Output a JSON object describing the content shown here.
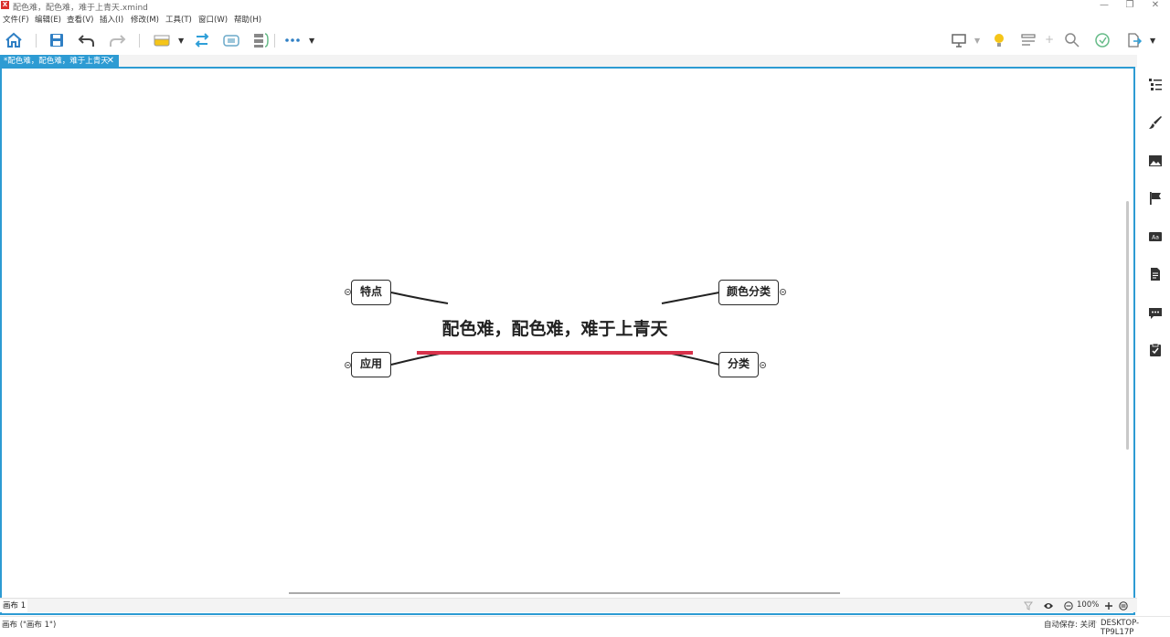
{
  "window": {
    "title": "配色难，配色难，难于上青天.xmind",
    "logo": "X"
  },
  "menu": [
    "文件(F)",
    "编辑(E)",
    "查看(V)",
    "插入(I)",
    "修改(M)",
    "工具(T)",
    "窗口(W)",
    "帮助(H)"
  ],
  "tab": {
    "label": "*配色难，配色难，难于上青天",
    "close": "✕"
  },
  "mindmap": {
    "central": "配色难，配色难，难于上青天",
    "topics": {
      "top_left": "特点",
      "bottom_left": "应用",
      "top_right": "颜色分类",
      "bottom_right": "分类"
    },
    "accent_color": "#d8314a"
  },
  "statusbar": {
    "sheet": "画布 1",
    "zoom": "100%"
  },
  "bottombar": {
    "left": "画布 (\"画布 1\")",
    "autosave": "自动保存: 关闭",
    "machine": "DESKTOP-TP9L17P"
  },
  "colors": {
    "accent_blue": "#2d9bd3",
    "icon_blue": "#2f7fc4"
  }
}
